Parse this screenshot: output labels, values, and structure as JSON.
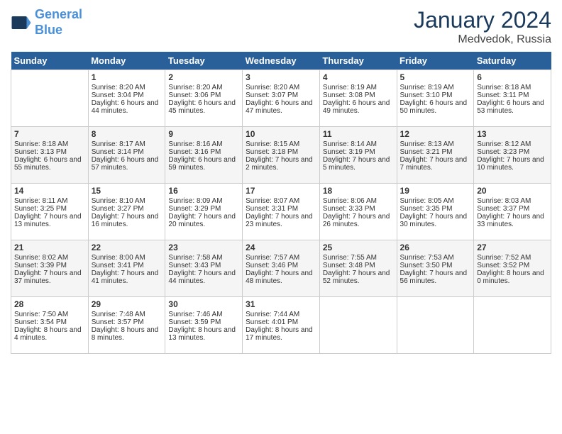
{
  "header": {
    "logo_line1": "General",
    "logo_line2": "Blue",
    "month": "January 2024",
    "location": "Medvedok, Russia"
  },
  "days_of_week": [
    "Sunday",
    "Monday",
    "Tuesday",
    "Wednesday",
    "Thursday",
    "Friday",
    "Saturday"
  ],
  "weeks": [
    [
      {
        "day": "",
        "sunrise": "",
        "sunset": "",
        "daylight": ""
      },
      {
        "day": "1",
        "sunrise": "Sunrise: 8:20 AM",
        "sunset": "Sunset: 3:04 PM",
        "daylight": "Daylight: 6 hours and 44 minutes."
      },
      {
        "day": "2",
        "sunrise": "Sunrise: 8:20 AM",
        "sunset": "Sunset: 3:06 PM",
        "daylight": "Daylight: 6 hours and 45 minutes."
      },
      {
        "day": "3",
        "sunrise": "Sunrise: 8:20 AM",
        "sunset": "Sunset: 3:07 PM",
        "daylight": "Daylight: 6 hours and 47 minutes."
      },
      {
        "day": "4",
        "sunrise": "Sunrise: 8:19 AM",
        "sunset": "Sunset: 3:08 PM",
        "daylight": "Daylight: 6 hours and 49 minutes."
      },
      {
        "day": "5",
        "sunrise": "Sunrise: 8:19 AM",
        "sunset": "Sunset: 3:10 PM",
        "daylight": "Daylight: 6 hours and 50 minutes."
      },
      {
        "day": "6",
        "sunrise": "Sunrise: 8:18 AM",
        "sunset": "Sunset: 3:11 PM",
        "daylight": "Daylight: 6 hours and 53 minutes."
      }
    ],
    [
      {
        "day": "7",
        "sunrise": "Sunrise: 8:18 AM",
        "sunset": "Sunset: 3:13 PM",
        "daylight": "Daylight: 6 hours and 55 minutes."
      },
      {
        "day": "8",
        "sunrise": "Sunrise: 8:17 AM",
        "sunset": "Sunset: 3:14 PM",
        "daylight": "Daylight: 6 hours and 57 minutes."
      },
      {
        "day": "9",
        "sunrise": "Sunrise: 8:16 AM",
        "sunset": "Sunset: 3:16 PM",
        "daylight": "Daylight: 6 hours and 59 minutes."
      },
      {
        "day": "10",
        "sunrise": "Sunrise: 8:15 AM",
        "sunset": "Sunset: 3:18 PM",
        "daylight": "Daylight: 7 hours and 2 minutes."
      },
      {
        "day": "11",
        "sunrise": "Sunrise: 8:14 AM",
        "sunset": "Sunset: 3:19 PM",
        "daylight": "Daylight: 7 hours and 5 minutes."
      },
      {
        "day": "12",
        "sunrise": "Sunrise: 8:13 AM",
        "sunset": "Sunset: 3:21 PM",
        "daylight": "Daylight: 7 hours and 7 minutes."
      },
      {
        "day": "13",
        "sunrise": "Sunrise: 8:12 AM",
        "sunset": "Sunset: 3:23 PM",
        "daylight": "Daylight: 7 hours and 10 minutes."
      }
    ],
    [
      {
        "day": "14",
        "sunrise": "Sunrise: 8:11 AM",
        "sunset": "Sunset: 3:25 PM",
        "daylight": "Daylight: 7 hours and 13 minutes."
      },
      {
        "day": "15",
        "sunrise": "Sunrise: 8:10 AM",
        "sunset": "Sunset: 3:27 PM",
        "daylight": "Daylight: 7 hours and 16 minutes."
      },
      {
        "day": "16",
        "sunrise": "Sunrise: 8:09 AM",
        "sunset": "Sunset: 3:29 PM",
        "daylight": "Daylight: 7 hours and 20 minutes."
      },
      {
        "day": "17",
        "sunrise": "Sunrise: 8:07 AM",
        "sunset": "Sunset: 3:31 PM",
        "daylight": "Daylight: 7 hours and 23 minutes."
      },
      {
        "day": "18",
        "sunrise": "Sunrise: 8:06 AM",
        "sunset": "Sunset: 3:33 PM",
        "daylight": "Daylight: 7 hours and 26 minutes."
      },
      {
        "day": "19",
        "sunrise": "Sunrise: 8:05 AM",
        "sunset": "Sunset: 3:35 PM",
        "daylight": "Daylight: 7 hours and 30 minutes."
      },
      {
        "day": "20",
        "sunrise": "Sunrise: 8:03 AM",
        "sunset": "Sunset: 3:37 PM",
        "daylight": "Daylight: 7 hours and 33 minutes."
      }
    ],
    [
      {
        "day": "21",
        "sunrise": "Sunrise: 8:02 AM",
        "sunset": "Sunset: 3:39 PM",
        "daylight": "Daylight: 7 hours and 37 minutes."
      },
      {
        "day": "22",
        "sunrise": "Sunrise: 8:00 AM",
        "sunset": "Sunset: 3:41 PM",
        "daylight": "Daylight: 7 hours and 41 minutes."
      },
      {
        "day": "23",
        "sunrise": "Sunrise: 7:58 AM",
        "sunset": "Sunset: 3:43 PM",
        "daylight": "Daylight: 7 hours and 44 minutes."
      },
      {
        "day": "24",
        "sunrise": "Sunrise: 7:57 AM",
        "sunset": "Sunset: 3:46 PM",
        "daylight": "Daylight: 7 hours and 48 minutes."
      },
      {
        "day": "25",
        "sunrise": "Sunrise: 7:55 AM",
        "sunset": "Sunset: 3:48 PM",
        "daylight": "Daylight: 7 hours and 52 minutes."
      },
      {
        "day": "26",
        "sunrise": "Sunrise: 7:53 AM",
        "sunset": "Sunset: 3:50 PM",
        "daylight": "Daylight: 7 hours and 56 minutes."
      },
      {
        "day": "27",
        "sunrise": "Sunrise: 7:52 AM",
        "sunset": "Sunset: 3:52 PM",
        "daylight": "Daylight: 8 hours and 0 minutes."
      }
    ],
    [
      {
        "day": "28",
        "sunrise": "Sunrise: 7:50 AM",
        "sunset": "Sunset: 3:54 PM",
        "daylight": "Daylight: 8 hours and 4 minutes."
      },
      {
        "day": "29",
        "sunrise": "Sunrise: 7:48 AM",
        "sunset": "Sunset: 3:57 PM",
        "daylight": "Daylight: 8 hours and 8 minutes."
      },
      {
        "day": "30",
        "sunrise": "Sunrise: 7:46 AM",
        "sunset": "Sunset: 3:59 PM",
        "daylight": "Daylight: 8 hours and 13 minutes."
      },
      {
        "day": "31",
        "sunrise": "Sunrise: 7:44 AM",
        "sunset": "Sunset: 4:01 PM",
        "daylight": "Daylight: 8 hours and 17 minutes."
      },
      {
        "day": "",
        "sunrise": "",
        "sunset": "",
        "daylight": ""
      },
      {
        "day": "",
        "sunrise": "",
        "sunset": "",
        "daylight": ""
      },
      {
        "day": "",
        "sunrise": "",
        "sunset": "",
        "daylight": ""
      }
    ]
  ]
}
